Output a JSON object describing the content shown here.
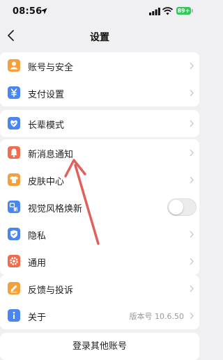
{
  "status_bar": {
    "time": "08:56",
    "battery": "89+"
  },
  "header": {
    "title": "设置"
  },
  "groups": [
    {
      "items": [
        {
          "label": "账号与安全",
          "icon": "person-icon",
          "color": "#f5a13b"
        },
        {
          "label": "支付设置",
          "icon": "yuan-icon",
          "color": "#4a86f0"
        }
      ]
    },
    {
      "items": [
        {
          "label": "长辈模式",
          "icon": "heart-icon",
          "color": "#4a86f0"
        }
      ]
    },
    {
      "items": [
        {
          "label": "新消息通知",
          "icon": "bell-icon",
          "color": "#f26b4a"
        },
        {
          "label": "皮肤中心",
          "icon": "shirt-icon",
          "color": "#f5a13b"
        },
        {
          "label": "视觉风格焕新",
          "icon": "new-style-icon",
          "color": "#4a86f0",
          "toggle": false
        },
        {
          "label": "隐私",
          "icon": "shield-icon",
          "color": "#4a86f0"
        },
        {
          "label": "通用",
          "icon": "gear-icon",
          "color": "#f26b4a"
        }
      ]
    },
    {
      "items": [
        {
          "label": "反馈与投诉",
          "icon": "pencil-icon",
          "color": "#f5a13b"
        },
        {
          "label": "关于",
          "icon": "info-icon",
          "color": "#4a86f0",
          "value": "版本号 10.6.50"
        }
      ]
    }
  ],
  "login_other": "登录其他账号",
  "annotation": {
    "color": "#e0605c"
  }
}
